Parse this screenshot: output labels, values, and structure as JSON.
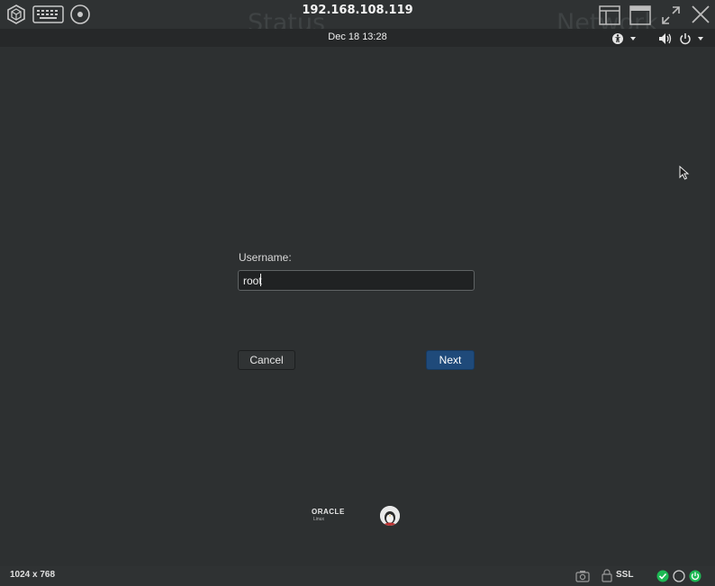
{
  "vnc": {
    "title": "192.168.108.119",
    "ghost_left": "Status",
    "ghost_right": "Network",
    "resolution": "1024 x 768",
    "ssl_label": "SSL"
  },
  "gnome": {
    "clock": "Dec 18  13:28"
  },
  "login": {
    "username_label": "Username:",
    "username_value": "root",
    "cancel_label": "Cancel",
    "next_label": "Next"
  },
  "branding": {
    "oracle_word": "ORACLE",
    "oracle_sub": "Linux"
  },
  "icons": {
    "top_left": [
      "cube-icon",
      "keyboard-icon",
      "disc-icon"
    ],
    "top_right": [
      "window-icon",
      "maximize-icon",
      "expand-icon",
      "close-icon"
    ],
    "gnome_right": [
      "accessibility-icon",
      "volume-icon",
      "power-icon"
    ],
    "bottom_right": [
      "camera-icon",
      "lock-icon",
      "check-circle-icon",
      "circle-icon",
      "power-circle-icon"
    ]
  },
  "colors": {
    "desktop_bg": "#2d3031",
    "next_button": "#1f4a7a",
    "status_green": "#1db954"
  }
}
